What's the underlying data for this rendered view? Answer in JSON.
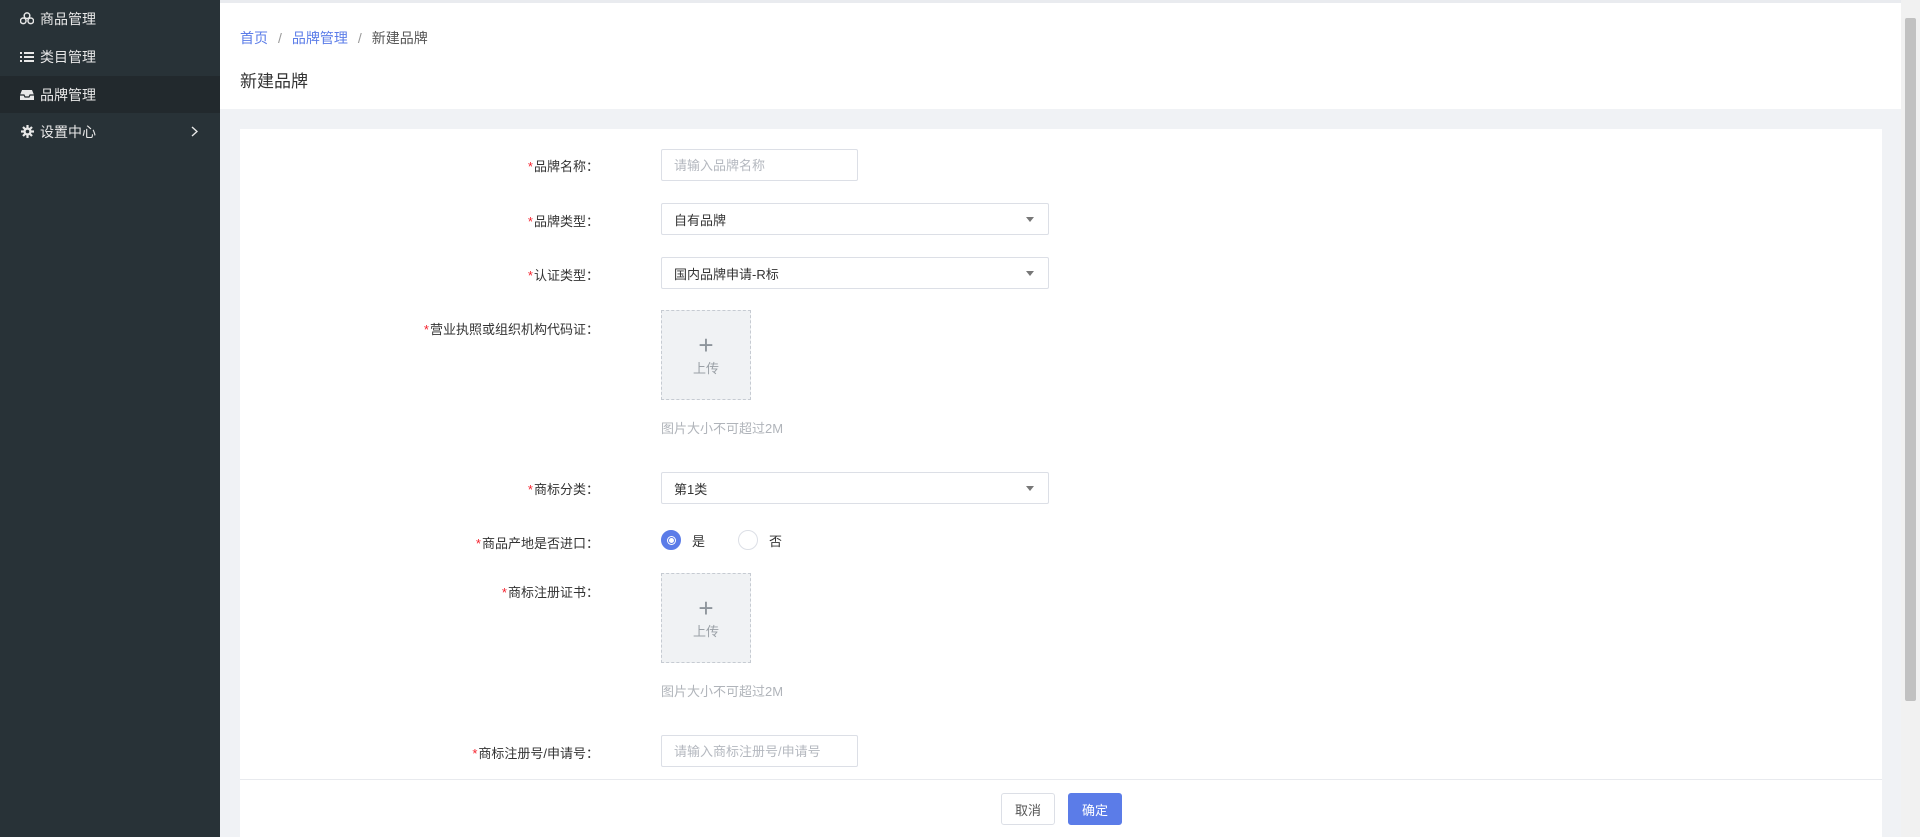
{
  "sidebar": {
    "items": [
      {
        "label": "商品管理",
        "icon": "cubes-icon"
      },
      {
        "label": "类目管理",
        "icon": "list-icon"
      },
      {
        "label": "品牌管理",
        "icon": "inbox-icon",
        "active": true
      },
      {
        "label": "设置中心",
        "icon": "gear-icon",
        "has_submenu": true
      }
    ]
  },
  "header": {
    "breadcrumb": [
      "首页",
      "品牌管理",
      "新建品牌"
    ],
    "title": "新建品牌"
  },
  "form": {
    "brand_name": {
      "label": "品牌名称：",
      "placeholder": "请输入品牌名称",
      "value": ""
    },
    "brand_type": {
      "label": "品牌类型：",
      "value": "自有品牌"
    },
    "cert_type": {
      "label": "认证类型：",
      "value": "国内品牌申请-R标"
    },
    "license": {
      "label": "营业执照或组织机构代码证：",
      "upload_text": "上传",
      "hint": "图片大小不可超过2M"
    },
    "trademark_class": {
      "label": "商标分类：",
      "value": "第1类"
    },
    "imported": {
      "label": "商品产地是否进口：",
      "options": [
        "是",
        "否"
      ],
      "selected": "是"
    },
    "trademark_cert": {
      "label": "商标注册证书：",
      "upload_text": "上传",
      "hint": "图片大小不可超过2M"
    },
    "trademark_no": {
      "label": "商标注册号/申请号：",
      "placeholder": "请输入商标注册号/申请号",
      "value": ""
    }
  },
  "actions": {
    "cancel": "取消",
    "confirm": "确定"
  },
  "colors": {
    "sidebar_bg": "#283237",
    "primary": "#5b7ce8",
    "required": "#f5222d"
  }
}
